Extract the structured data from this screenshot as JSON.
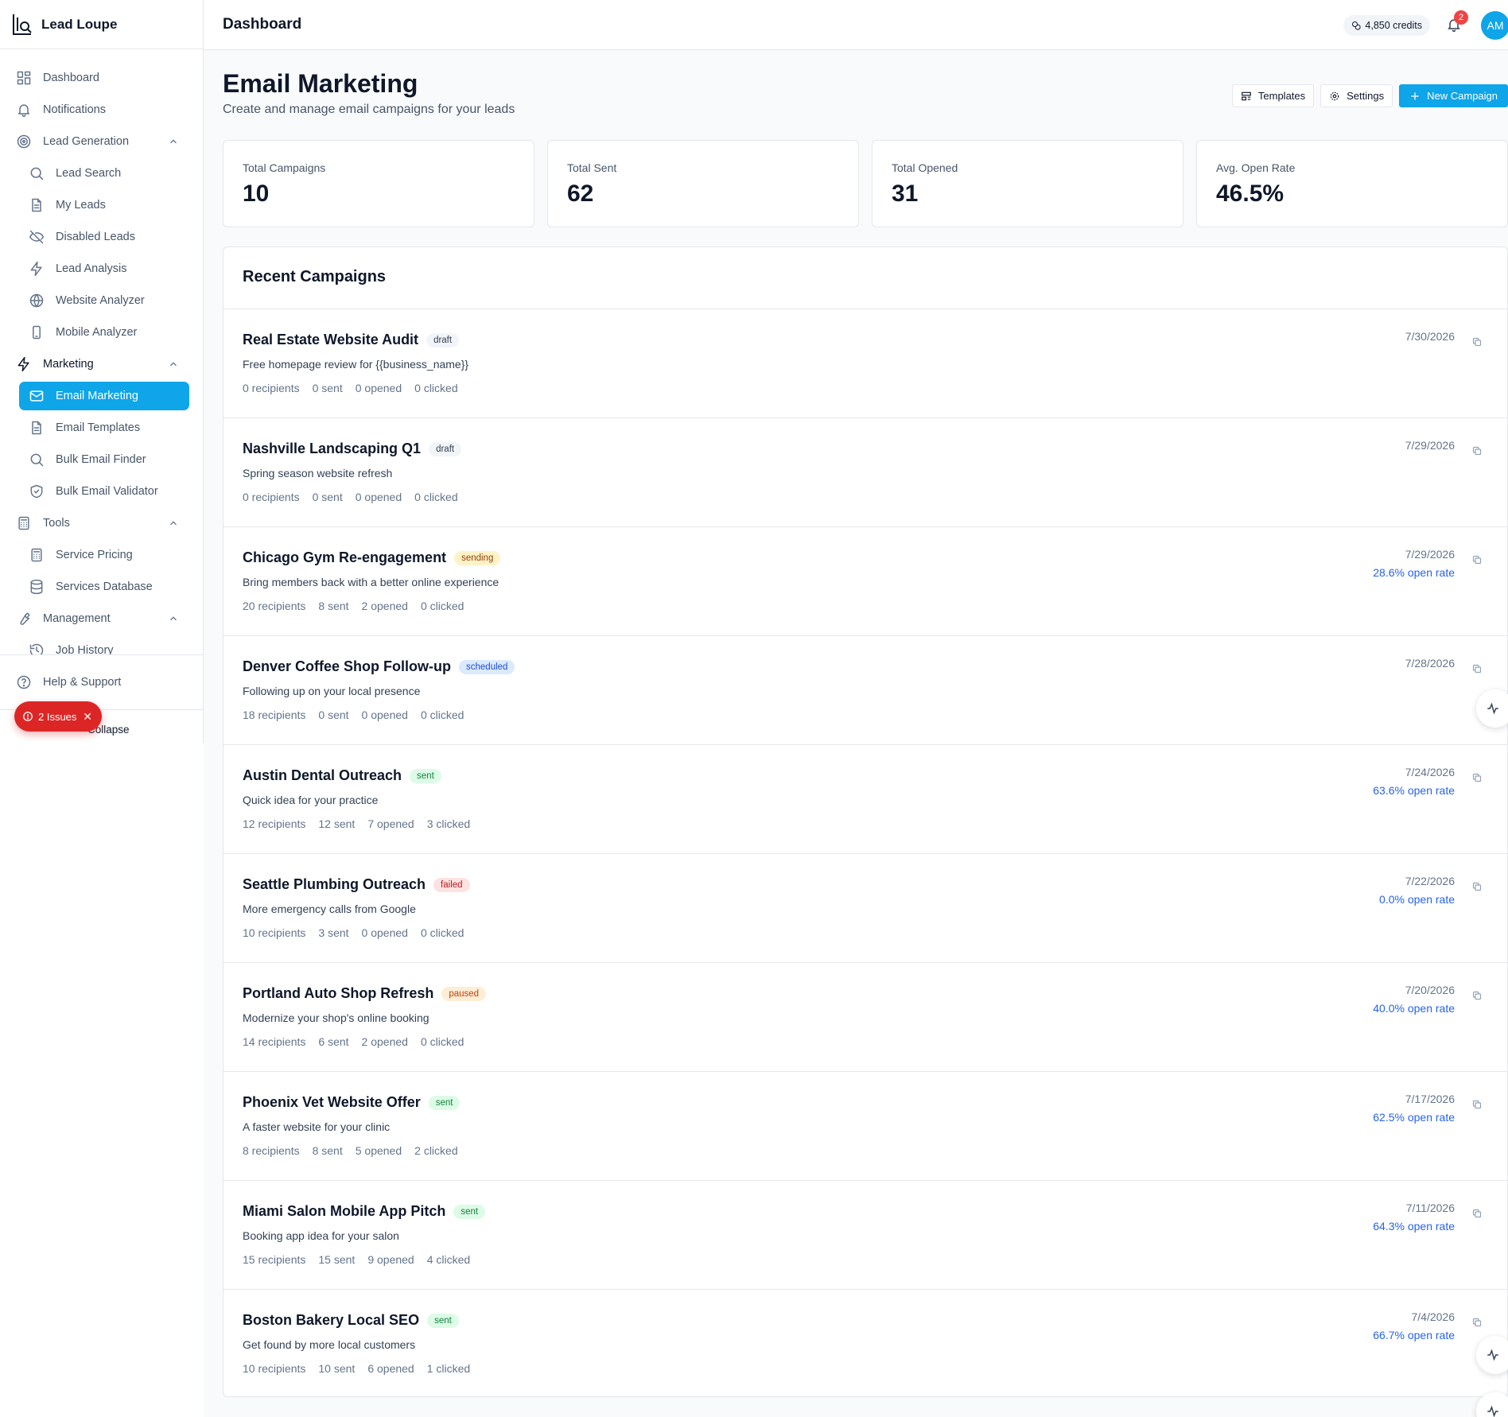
{
  "app": {
    "name": "Lead Loupe"
  },
  "header": {
    "title": "Dashboard",
    "credits": "4,850 credits",
    "notifications_count": "2",
    "avatar_initials": "AM"
  },
  "sidebar": {
    "items": [
      {
        "label": "Dashboard",
        "icon": "grid-icon",
        "level": "top"
      },
      {
        "label": "Notifications",
        "icon": "bell-icon",
        "level": "top"
      },
      {
        "label": "Lead Generation",
        "icon": "target-icon",
        "level": "section"
      },
      {
        "label": "Lead Search",
        "icon": "search-icon",
        "level": "sub"
      },
      {
        "label": "My Leads",
        "icon": "file-icon",
        "level": "sub"
      },
      {
        "label": "Disabled Leads",
        "icon": "eye-off-icon",
        "level": "sub"
      },
      {
        "label": "Lead Analysis",
        "icon": "zap-icon",
        "level": "sub"
      },
      {
        "label": "Website Analyzer",
        "icon": "globe-icon",
        "level": "sub"
      },
      {
        "label": "Mobile Analyzer",
        "icon": "phone-icon",
        "level": "sub"
      },
      {
        "label": "Marketing",
        "icon": "zap-icon",
        "level": "section-strong"
      },
      {
        "label": "Email Marketing",
        "icon": "mail-icon",
        "level": "active"
      },
      {
        "label": "Email Templates",
        "icon": "file-icon",
        "level": "sub"
      },
      {
        "label": "Bulk Email Finder",
        "icon": "search-icon",
        "level": "sub"
      },
      {
        "label": "Bulk Email Validator",
        "icon": "shield-icon",
        "level": "sub"
      },
      {
        "label": "Tools",
        "icon": "calculator-icon",
        "level": "section"
      },
      {
        "label": "Service Pricing",
        "icon": "calculator-icon",
        "level": "sub"
      },
      {
        "label": "Services Database",
        "icon": "database-icon",
        "level": "sub"
      },
      {
        "label": "Management",
        "icon": "wrench-icon",
        "level": "section"
      },
      {
        "label": "Job History",
        "icon": "history-icon",
        "level": "sub"
      }
    ],
    "help": "Help & Support",
    "collapse": "Collapse",
    "issues": "2 Issues"
  },
  "page": {
    "title": "Email Marketing",
    "subtitle": "Create and manage email campaigns for your leads",
    "actions": {
      "templates": "Templates",
      "settings": "Settings",
      "new_campaign": "New Campaign"
    }
  },
  "stats": [
    {
      "label": "Total Campaigns",
      "value": "10"
    },
    {
      "label": "Total Sent",
      "value": "62"
    },
    {
      "label": "Total Opened",
      "value": "31"
    },
    {
      "label": "Avg. Open Rate",
      "value": "46.5%"
    }
  ],
  "campaigns_title": "Recent Campaigns",
  "campaigns": [
    {
      "name": "Real Estate Website Audit",
      "status": "draft",
      "subject": "Free homepage review for {{business_name}}",
      "recipients": "0 recipients",
      "sent": "0 sent",
      "opened": "0 opened",
      "clicked": "0 clicked",
      "date": "7/30/2026",
      "open_rate": ""
    },
    {
      "name": "Nashville Landscaping Q1",
      "status": "draft",
      "subject": "Spring season website refresh",
      "recipients": "0 recipients",
      "sent": "0 sent",
      "opened": "0 opened",
      "clicked": "0 clicked",
      "date": "7/29/2026",
      "open_rate": ""
    },
    {
      "name": "Chicago Gym Re-engagement",
      "status": "sending",
      "subject": "Bring members back with a better online experience",
      "recipients": "20 recipients",
      "sent": "8 sent",
      "opened": "2 opened",
      "clicked": "0 clicked",
      "date": "7/29/2026",
      "open_rate": "28.6% open rate"
    },
    {
      "name": "Denver Coffee Shop Follow-up",
      "status": "scheduled",
      "subject": "Following up on your local presence",
      "recipients": "18 recipients",
      "sent": "0 sent",
      "opened": "0 opened",
      "clicked": "0 clicked",
      "date": "7/28/2026",
      "open_rate": ""
    },
    {
      "name": "Austin Dental Outreach",
      "status": "sent",
      "subject": "Quick idea for your practice",
      "recipients": "12 recipients",
      "sent": "12 sent",
      "opened": "7 opened",
      "clicked": "3 clicked",
      "date": "7/24/2026",
      "open_rate": "63.6% open rate"
    },
    {
      "name": "Seattle Plumbing Outreach",
      "status": "failed",
      "subject": "More emergency calls from Google",
      "recipients": "10 recipients",
      "sent": "3 sent",
      "opened": "0 opened",
      "clicked": "0 clicked",
      "date": "7/22/2026",
      "open_rate": "0.0% open rate"
    },
    {
      "name": "Portland Auto Shop Refresh",
      "status": "paused",
      "subject": "Modernize your shop's online booking",
      "recipients": "14 recipients",
      "sent": "6 sent",
      "opened": "2 opened",
      "clicked": "0 clicked",
      "date": "7/20/2026",
      "open_rate": "40.0% open rate"
    },
    {
      "name": "Phoenix Vet Website Offer",
      "status": "sent",
      "subject": "A faster website for your clinic",
      "recipients": "8 recipients",
      "sent": "8 sent",
      "opened": "5 opened",
      "clicked": "2 clicked",
      "date": "7/17/2026",
      "open_rate": "62.5% open rate"
    },
    {
      "name": "Miami Salon Mobile App Pitch",
      "status": "sent",
      "subject": "Booking app idea for your salon",
      "recipients": "15 recipients",
      "sent": "15 sent",
      "opened": "9 opened",
      "clicked": "4 clicked",
      "date": "7/11/2026",
      "open_rate": "64.3% open rate"
    },
    {
      "name": "Boston Bakery Local SEO",
      "status": "sent",
      "subject": "Get found by more local customers",
      "recipients": "10 recipients",
      "sent": "10 sent",
      "opened": "6 opened",
      "clicked": "1 clicked",
      "date": "7/4/2026",
      "open_rate": "66.7% open rate"
    }
  ],
  "colors": {
    "accent": "#0ea5e9",
    "link": "#2563eb",
    "danger": "#dc2626"
  }
}
